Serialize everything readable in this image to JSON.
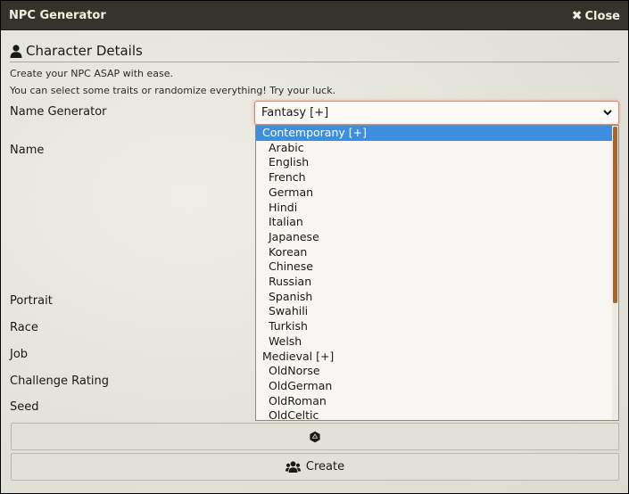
{
  "window": {
    "title": "NPC Generator",
    "close_label": "Close"
  },
  "section": {
    "title": "Character Details"
  },
  "hints": [
    "Create your NPC ASAP with ease.",
    "You can select some traits or randomize everything! Try your luck."
  ],
  "fields": {
    "name_generator": "Name Generator",
    "name": "Name",
    "portrait": "Portrait",
    "race": "Race",
    "job": "Job",
    "challenge_rating": "Challenge Rating",
    "seed": "Seed"
  },
  "name_generator_select": {
    "selected": "Fantasy [+]",
    "options": [
      {
        "label": "Contemporany [+]",
        "kind": "group",
        "highlighted": true
      },
      {
        "label": "Arabic",
        "kind": "child"
      },
      {
        "label": "English",
        "kind": "child"
      },
      {
        "label": "French",
        "kind": "child"
      },
      {
        "label": "German",
        "kind": "child"
      },
      {
        "label": "Hindi",
        "kind": "child"
      },
      {
        "label": "Italian",
        "kind": "child"
      },
      {
        "label": "Japanese",
        "kind": "child"
      },
      {
        "label": "Korean",
        "kind": "child"
      },
      {
        "label": "Chinese",
        "kind": "child"
      },
      {
        "label": "Russian",
        "kind": "child"
      },
      {
        "label": "Spanish",
        "kind": "child"
      },
      {
        "label": "Swahili",
        "kind": "child"
      },
      {
        "label": "Turkish",
        "kind": "child"
      },
      {
        "label": "Welsh",
        "kind": "child"
      },
      {
        "label": "Medieval [+]",
        "kind": "group"
      },
      {
        "label": "OldNorse",
        "kind": "child"
      },
      {
        "label": "OldGerman",
        "kind": "child"
      },
      {
        "label": "OldRoman",
        "kind": "child"
      },
      {
        "label": "OldCeltic",
        "kind": "child"
      }
    ]
  },
  "buttons": {
    "randomize_icon": "dice-icon",
    "create_label": "Create",
    "create_icon": "users-icon"
  },
  "colors": {
    "titlebar": "#34342c",
    "highlight": "#3e8edf",
    "scrollbar_thumb": "#b0622a",
    "focus_border": "#e0876f"
  }
}
